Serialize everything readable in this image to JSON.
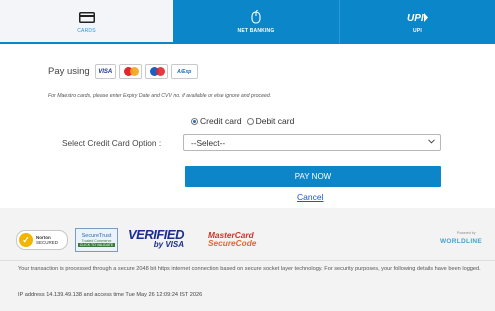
{
  "colors": {
    "accent": "#0b86c9",
    "link": "#1a57c9",
    "footer_bg": "#f3f3f4"
  },
  "tabs": [
    {
      "label": "CARDS",
      "icon": "credit-card-icon",
      "active": true
    },
    {
      "label": "NET BANKING",
      "icon": "mouse-icon",
      "active": false
    },
    {
      "label": "UPI",
      "icon": "upi-logo",
      "active": false
    }
  ],
  "upi_logo_text": "UPI",
  "pay_using": {
    "label": "Pay using",
    "logos": [
      {
        "name": "visa-logo",
        "text": "VISA"
      },
      {
        "name": "mastercard-logo",
        "text": ""
      },
      {
        "name": "maestro-logo",
        "text": ""
      },
      {
        "name": "amex-logo",
        "text": "A/Exp"
      }
    ]
  },
  "maestro_note": "For Maestro cards, please enter Expiry Date and CVV no. if available or else ignore and proceed.",
  "card_type": {
    "options": [
      "Credit card",
      "Debit card"
    ],
    "selected": "Credit card"
  },
  "select_option": {
    "label": "Select Credit Card Option :",
    "value": "--Select--"
  },
  "pay_button": "PAY NOW",
  "cancel_link": "Cancel",
  "footer": {
    "norton": {
      "line1": "Norton",
      "line2": "SECURED"
    },
    "securetrust": {
      "line1": "SecureTrust",
      "line2": "Trusted Commerce",
      "line3": "CLICK TO VALIDATE"
    },
    "verified_visa": {
      "line1": "VERIFIED",
      "line2": "by VISA"
    },
    "mastercard_secure": {
      "line1": "MasterCard",
      "line2": "SecureCode"
    },
    "worldline": {
      "powered": "Powered by",
      "name": "WORLDLINE"
    },
    "info": "Your transaction is processed through a secure 2048 bit https internet connection based on secure socket layer technology. For security purposes, your following details have been logged.",
    "ip": "IP address 14.139.49.138 and access time Tue May 26 12:09:24 IST 2026"
  }
}
